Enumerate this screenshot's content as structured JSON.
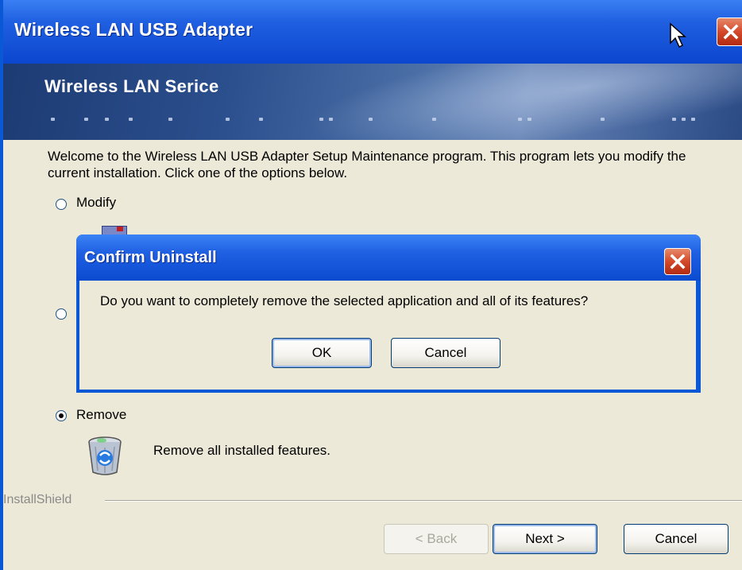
{
  "window": {
    "title": "Wireless LAN USB Adapter",
    "banner_title": "Wireless LAN Serice"
  },
  "content": {
    "intro": "Welcome to the Wireless LAN USB Adapter Setup Maintenance program. This program lets you modify the current installation. Click one of the options below.",
    "options": [
      {
        "label": "Modify",
        "selected": false
      },
      {
        "label": "",
        "selected": false
      },
      {
        "label": "Remove",
        "selected": true,
        "description": "Remove all installed features."
      }
    ]
  },
  "footer": {
    "brand": "InstallShield",
    "back_label": "< Back",
    "next_label": "Next >",
    "cancel_label": "Cancel"
  },
  "dialog": {
    "title": "Confirm Uninstall",
    "message": "Do you want to completely remove the selected application and all of its features?",
    "ok_label": "OK",
    "cancel_label": "Cancel"
  },
  "colors": {
    "titlebar": "#0b46cf",
    "window_bg": "#ece9d8",
    "close_button": "#d4492a"
  },
  "icons": [
    "close-icon",
    "cursor-icon",
    "modify-icon",
    "recycle-bin-icon"
  ]
}
